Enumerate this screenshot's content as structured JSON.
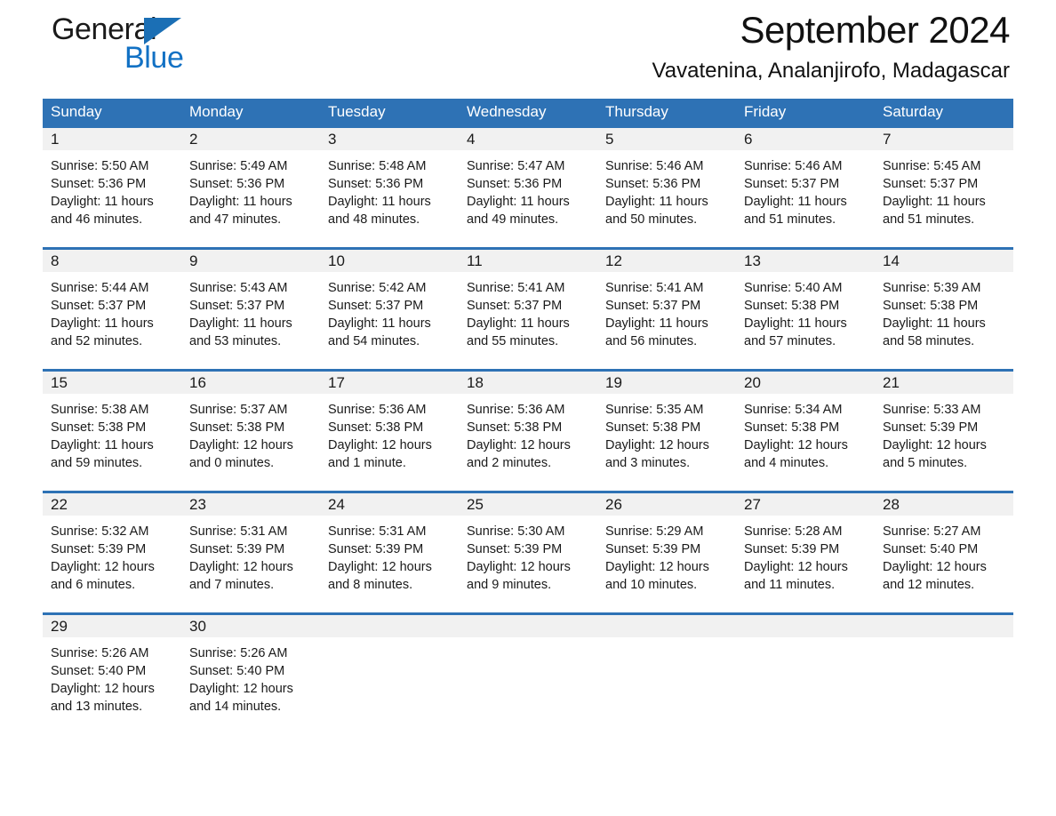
{
  "brand": {
    "name_part1": "General",
    "name_part2": "Blue",
    "triangle_color": "#1b6fb5",
    "blue_text_color": "#1271c4"
  },
  "header": {
    "title": "September 2024",
    "subtitle": "Vavatenina, Analanjirofo, Madagascar"
  },
  "theme": {
    "header_bg": "#2e72b5",
    "header_text": "#ffffff",
    "day_band_bg": "#f1f1f1",
    "row_border": "#2e72b5",
    "body_text": "#1a1a1a"
  },
  "weekdays": [
    "Sunday",
    "Monday",
    "Tuesday",
    "Wednesday",
    "Thursday",
    "Friday",
    "Saturday"
  ],
  "weeks": [
    [
      {
        "day": "1",
        "sunrise": "Sunrise: 5:50 AM",
        "sunset": "Sunset: 5:36 PM",
        "daylight": "Daylight: 11 hours and 46 minutes."
      },
      {
        "day": "2",
        "sunrise": "Sunrise: 5:49 AM",
        "sunset": "Sunset: 5:36 PM",
        "daylight": "Daylight: 11 hours and 47 minutes."
      },
      {
        "day": "3",
        "sunrise": "Sunrise: 5:48 AM",
        "sunset": "Sunset: 5:36 PM",
        "daylight": "Daylight: 11 hours and 48 minutes."
      },
      {
        "day": "4",
        "sunrise": "Sunrise: 5:47 AM",
        "sunset": "Sunset: 5:36 PM",
        "daylight": "Daylight: 11 hours and 49 minutes."
      },
      {
        "day": "5",
        "sunrise": "Sunrise: 5:46 AM",
        "sunset": "Sunset: 5:36 PM",
        "daylight": "Daylight: 11 hours and 50 minutes."
      },
      {
        "day": "6",
        "sunrise": "Sunrise: 5:46 AM",
        "sunset": "Sunset: 5:37 PM",
        "daylight": "Daylight: 11 hours and 51 minutes."
      },
      {
        "day": "7",
        "sunrise": "Sunrise: 5:45 AM",
        "sunset": "Sunset: 5:37 PM",
        "daylight": "Daylight: 11 hours and 51 minutes."
      }
    ],
    [
      {
        "day": "8",
        "sunrise": "Sunrise: 5:44 AM",
        "sunset": "Sunset: 5:37 PM",
        "daylight": "Daylight: 11 hours and 52 minutes."
      },
      {
        "day": "9",
        "sunrise": "Sunrise: 5:43 AM",
        "sunset": "Sunset: 5:37 PM",
        "daylight": "Daylight: 11 hours and 53 minutes."
      },
      {
        "day": "10",
        "sunrise": "Sunrise: 5:42 AM",
        "sunset": "Sunset: 5:37 PM",
        "daylight": "Daylight: 11 hours and 54 minutes."
      },
      {
        "day": "11",
        "sunrise": "Sunrise: 5:41 AM",
        "sunset": "Sunset: 5:37 PM",
        "daylight": "Daylight: 11 hours and 55 minutes."
      },
      {
        "day": "12",
        "sunrise": "Sunrise: 5:41 AM",
        "sunset": "Sunset: 5:37 PM",
        "daylight": "Daylight: 11 hours and 56 minutes."
      },
      {
        "day": "13",
        "sunrise": "Sunrise: 5:40 AM",
        "sunset": "Sunset: 5:38 PM",
        "daylight": "Daylight: 11 hours and 57 minutes."
      },
      {
        "day": "14",
        "sunrise": "Sunrise: 5:39 AM",
        "sunset": "Sunset: 5:38 PM",
        "daylight": "Daylight: 11 hours and 58 minutes."
      }
    ],
    [
      {
        "day": "15",
        "sunrise": "Sunrise: 5:38 AM",
        "sunset": "Sunset: 5:38 PM",
        "daylight": "Daylight: 11 hours and 59 minutes."
      },
      {
        "day": "16",
        "sunrise": "Sunrise: 5:37 AM",
        "sunset": "Sunset: 5:38 PM",
        "daylight": "Daylight: 12 hours and 0 minutes."
      },
      {
        "day": "17",
        "sunrise": "Sunrise: 5:36 AM",
        "sunset": "Sunset: 5:38 PM",
        "daylight": "Daylight: 12 hours and 1 minute."
      },
      {
        "day": "18",
        "sunrise": "Sunrise: 5:36 AM",
        "sunset": "Sunset: 5:38 PM",
        "daylight": "Daylight: 12 hours and 2 minutes."
      },
      {
        "day": "19",
        "sunrise": "Sunrise: 5:35 AM",
        "sunset": "Sunset: 5:38 PM",
        "daylight": "Daylight: 12 hours and 3 minutes."
      },
      {
        "day": "20",
        "sunrise": "Sunrise: 5:34 AM",
        "sunset": "Sunset: 5:38 PM",
        "daylight": "Daylight: 12 hours and 4 minutes."
      },
      {
        "day": "21",
        "sunrise": "Sunrise: 5:33 AM",
        "sunset": "Sunset: 5:39 PM",
        "daylight": "Daylight: 12 hours and 5 minutes."
      }
    ],
    [
      {
        "day": "22",
        "sunrise": "Sunrise: 5:32 AM",
        "sunset": "Sunset: 5:39 PM",
        "daylight": "Daylight: 12 hours and 6 minutes."
      },
      {
        "day": "23",
        "sunrise": "Sunrise: 5:31 AM",
        "sunset": "Sunset: 5:39 PM",
        "daylight": "Daylight: 12 hours and 7 minutes."
      },
      {
        "day": "24",
        "sunrise": "Sunrise: 5:31 AM",
        "sunset": "Sunset: 5:39 PM",
        "daylight": "Daylight: 12 hours and 8 minutes."
      },
      {
        "day": "25",
        "sunrise": "Sunrise: 5:30 AM",
        "sunset": "Sunset: 5:39 PM",
        "daylight": "Daylight: 12 hours and 9 minutes."
      },
      {
        "day": "26",
        "sunrise": "Sunrise: 5:29 AM",
        "sunset": "Sunset: 5:39 PM",
        "daylight": "Daylight: 12 hours and 10 minutes."
      },
      {
        "day": "27",
        "sunrise": "Sunrise: 5:28 AM",
        "sunset": "Sunset: 5:39 PM",
        "daylight": "Daylight: 12 hours and 11 minutes."
      },
      {
        "day": "28",
        "sunrise": "Sunrise: 5:27 AM",
        "sunset": "Sunset: 5:40 PM",
        "daylight": "Daylight: 12 hours and 12 minutes."
      }
    ],
    [
      {
        "day": "29",
        "sunrise": "Sunrise: 5:26 AM",
        "sunset": "Sunset: 5:40 PM",
        "daylight": "Daylight: 12 hours and 13 minutes."
      },
      {
        "day": "30",
        "sunrise": "Sunrise: 5:26 AM",
        "sunset": "Sunset: 5:40 PM",
        "daylight": "Daylight: 12 hours and 14 minutes."
      },
      {
        "day": "",
        "sunrise": "",
        "sunset": "",
        "daylight": ""
      },
      {
        "day": "",
        "sunrise": "",
        "sunset": "",
        "daylight": ""
      },
      {
        "day": "",
        "sunrise": "",
        "sunset": "",
        "daylight": ""
      },
      {
        "day": "",
        "sunrise": "",
        "sunset": "",
        "daylight": ""
      },
      {
        "day": "",
        "sunrise": "",
        "sunset": "",
        "daylight": ""
      }
    ]
  ]
}
